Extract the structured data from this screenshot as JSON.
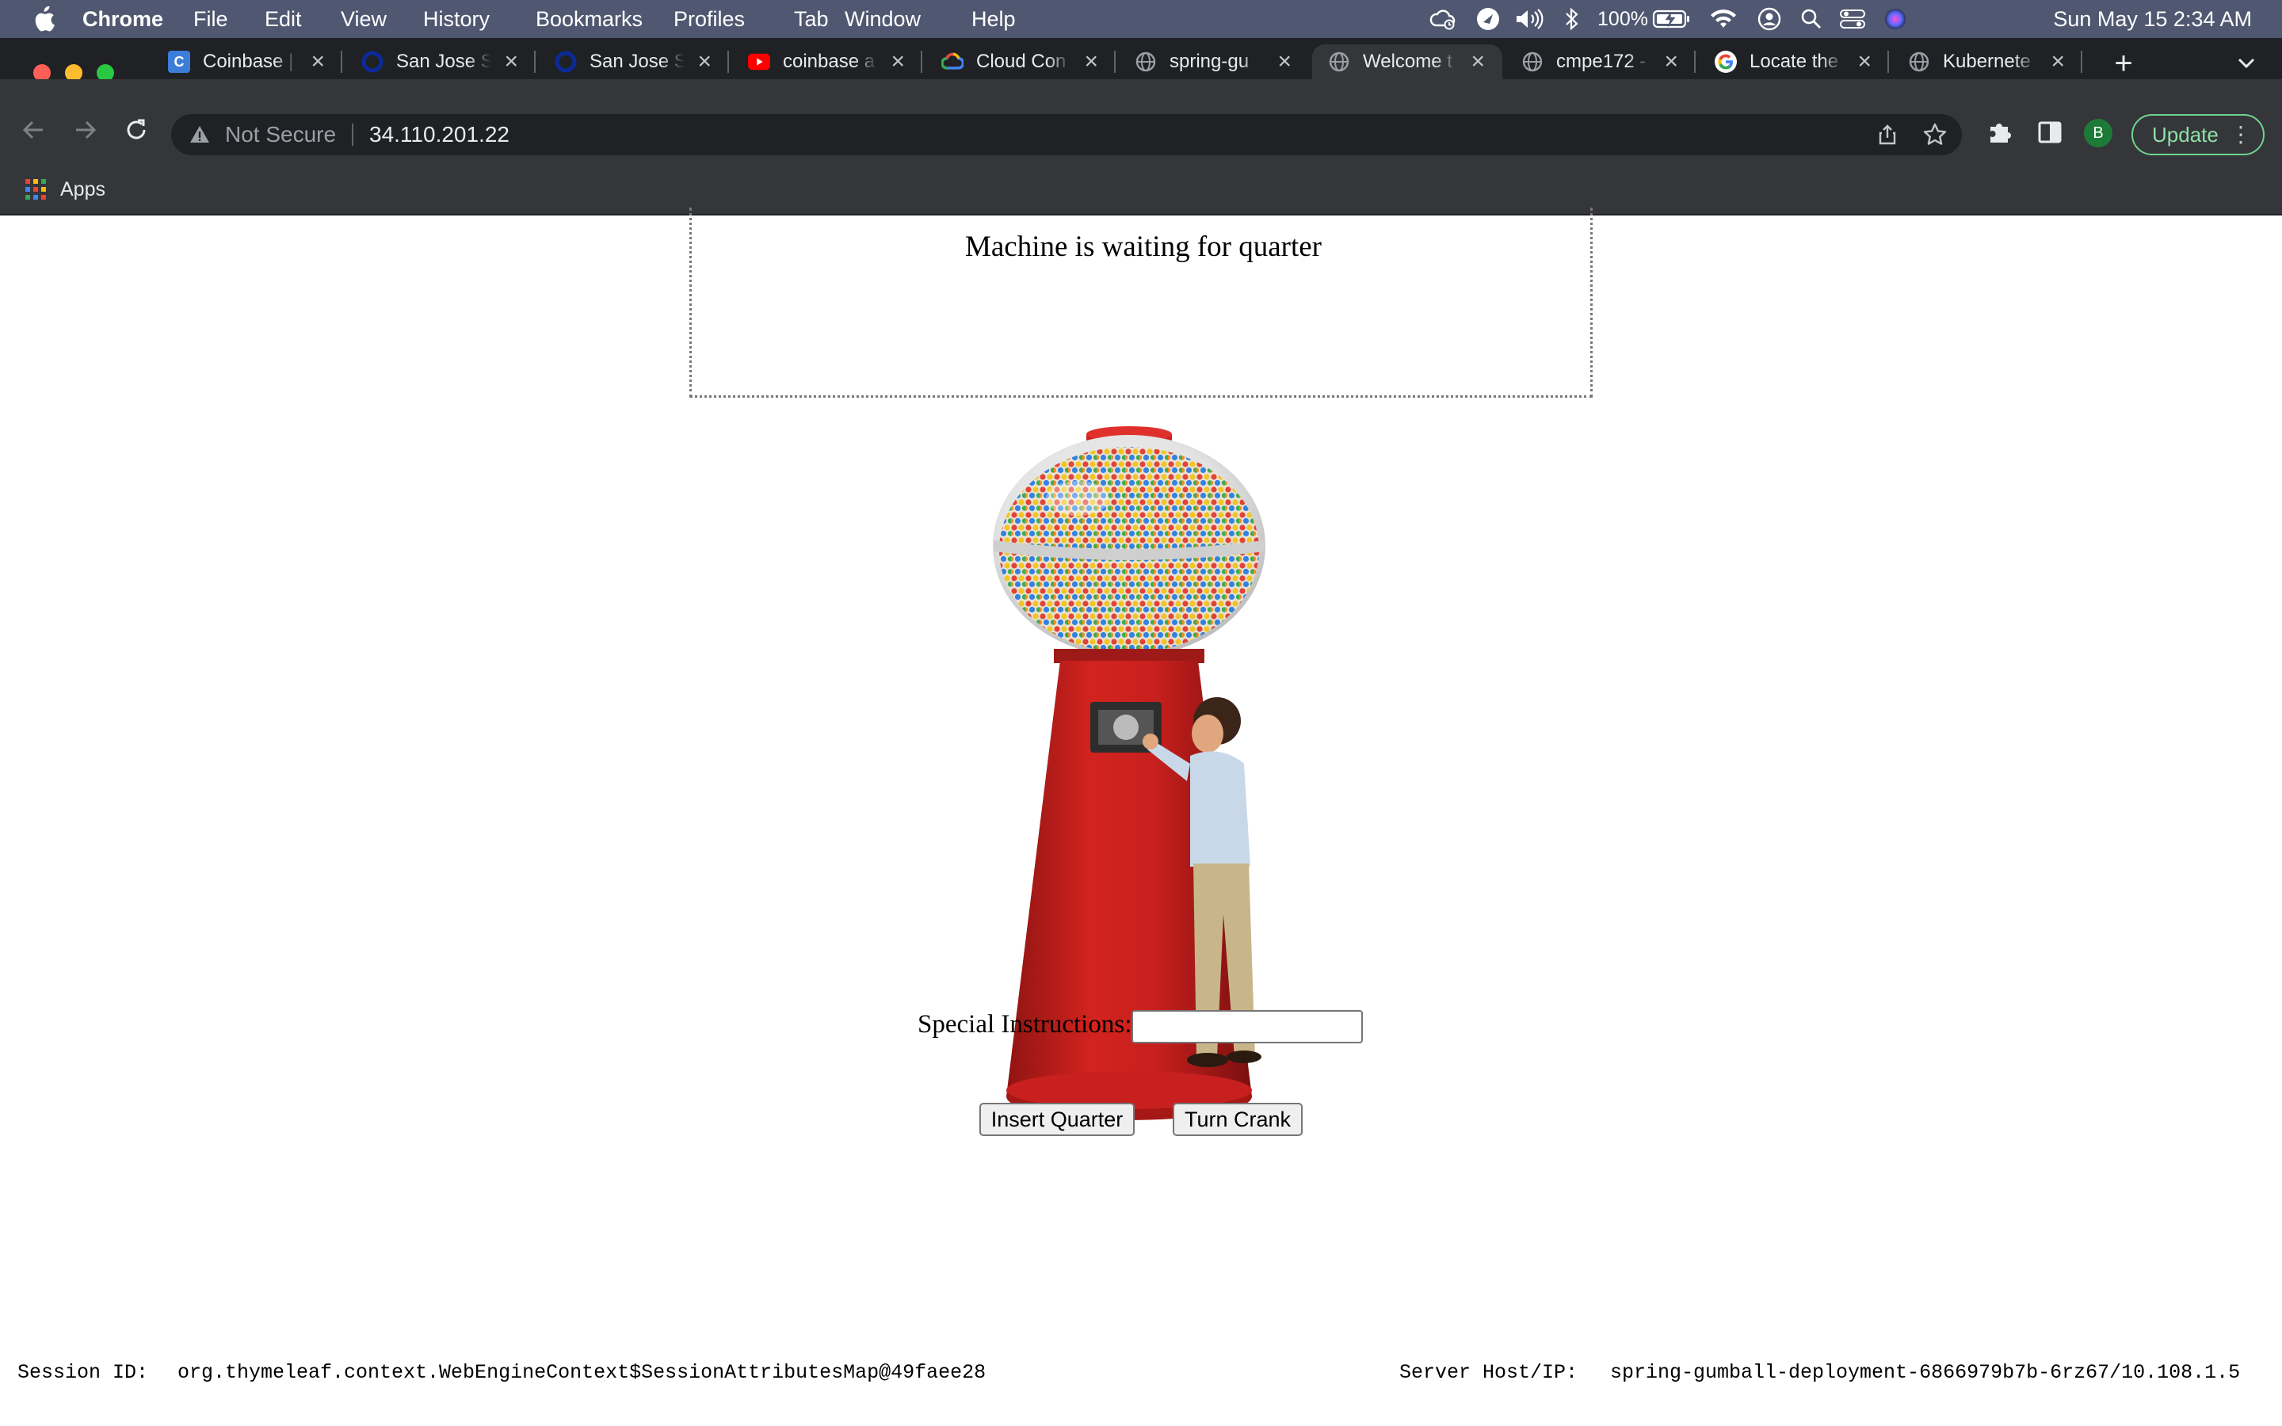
{
  "menubar": {
    "app_name": "Chrome",
    "items": [
      "File",
      "Edit",
      "View",
      "History",
      "Bookmarks",
      "Profiles",
      "Tab",
      "Window",
      "Help"
    ],
    "battery": "100%",
    "datetime": "Sun May 15  2:34 AM"
  },
  "tabs": [
    {
      "title": "Coinbase |",
      "icon": "coinbase-c-icon",
      "color": "#1652f0"
    },
    {
      "title": "San Jose S",
      "icon": "sjsu-icon",
      "color": "#0b2a7a"
    },
    {
      "title": "San Jose S",
      "icon": "sjsu-icon",
      "color": "#0b2a7a"
    },
    {
      "title": "coinbase a",
      "icon": "youtube-icon",
      "color": "#ff0000"
    },
    {
      "title": "Cloud Con",
      "icon": "google-cloud-icon",
      "color": "#4285f4"
    },
    {
      "title": "spring-gu",
      "icon": "globe-icon",
      "color": "#9aa0a6"
    },
    {
      "title": "Welcome t",
      "icon": "globe-icon",
      "color": "#9aa0a6",
      "active": true
    },
    {
      "title": "cmpe172 -",
      "icon": "globe-icon",
      "color": "#9aa0a6"
    },
    {
      "title": "Locate the",
      "icon": "google-icon",
      "color": "#4285f4"
    },
    {
      "title": "Kubernete",
      "icon": "globe-icon",
      "color": "#9aa0a6"
    }
  ],
  "omnibox": {
    "security_label": "Not Secure",
    "url": "34.110.201.22"
  },
  "toolbar": {
    "profile_initial": "B",
    "update_label": "Update"
  },
  "bookmarks": {
    "apps_label": "Apps"
  },
  "page": {
    "message": "Machine is waiting for quarter",
    "instructions_label": "Special Instructions:",
    "instructions_value": "",
    "insert_button": "Insert Quarter",
    "crank_button": "Turn Crank",
    "session_label": "Session ID:",
    "session_value": "org.thymeleaf.context.WebEngineContext$SessionAttributesMap@49faee28",
    "server_label": "Server Host/IP:",
    "server_value": "spring-gumball-deployment-6866979b7b-6rz67/10.108.1.5"
  },
  "colors": {
    "menubar_bg": "#4f5870",
    "tabstrip_bg": "#202124",
    "toolbar_bg": "#35363a",
    "update_green": "#6dd58c",
    "gumball_red": "#c8201e"
  }
}
